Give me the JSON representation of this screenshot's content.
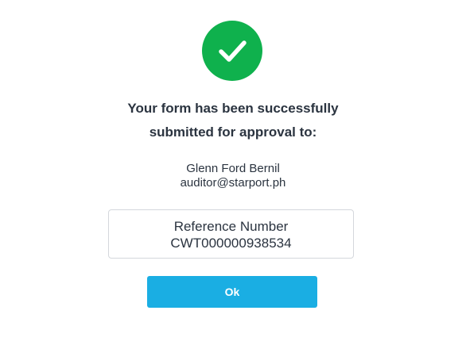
{
  "dialog": {
    "icon": "checkmark-icon",
    "status_color": "#0fb14d",
    "headline_line1": "Your form has been successfully",
    "headline_line2": "submitted for approval to:",
    "recipient_name": "Glenn Ford Bernil",
    "recipient_email": "auditor@starport.ph",
    "reference_label": "Reference Number",
    "reference_value": "CWT000000938534",
    "ok_label": "Ok",
    "button_color": "#1aaee3"
  }
}
